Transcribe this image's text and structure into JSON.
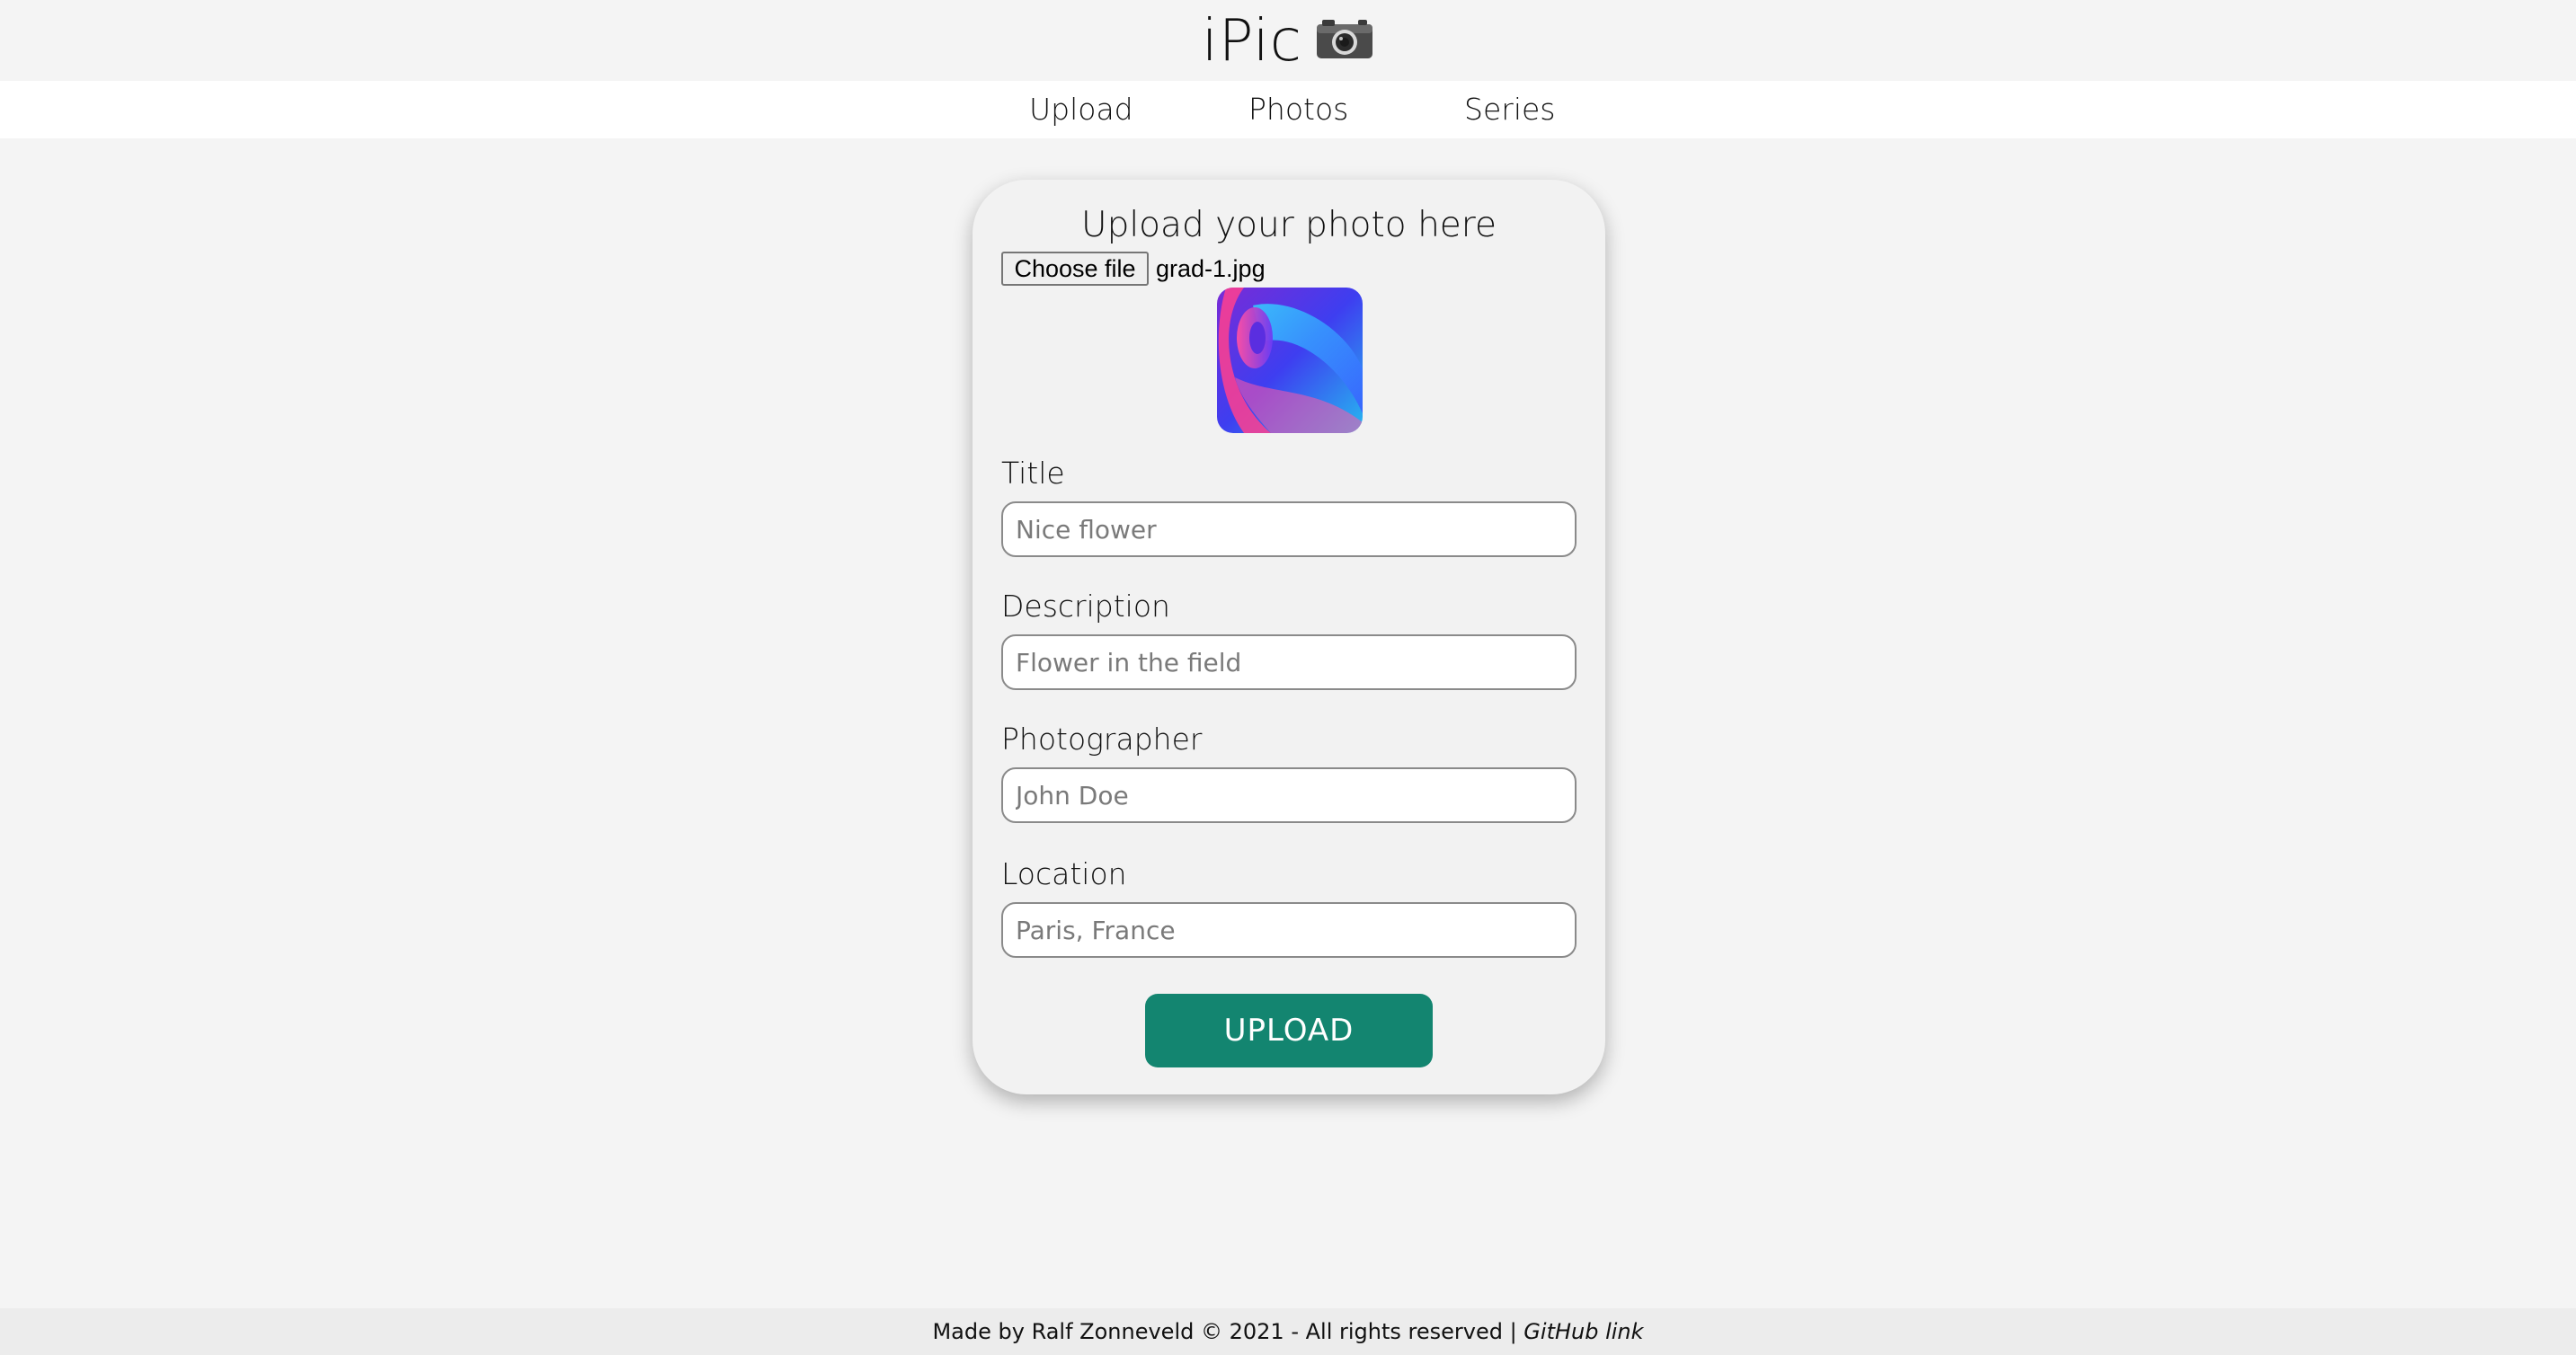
{
  "header": {
    "title": "iPic",
    "title_icon": "camera-icon"
  },
  "nav": {
    "items": [
      {
        "label": "Upload"
      },
      {
        "label": "Photos"
      },
      {
        "label": "Series"
      }
    ]
  },
  "form": {
    "heading": "Upload your photo here",
    "file_button_label": "Choose file",
    "file_name": "grad-1.jpg",
    "fields": [
      {
        "label": "Title",
        "placeholder": "Nice flower",
        "value": ""
      },
      {
        "label": "Description",
        "placeholder": "Flower in the field",
        "value": ""
      },
      {
        "label": "Photographer",
        "placeholder": "John Doe",
        "value": ""
      },
      {
        "label": "Location",
        "placeholder": "Paris, France",
        "value": ""
      }
    ],
    "submit_label": "UPLOAD"
  },
  "footer": {
    "text": "Made by Ralf Zonneveld © 2021 - All rights reserved | ",
    "link_label": "GitHub link"
  },
  "colors": {
    "accent": "#138570",
    "background": "#f4f4f4",
    "nav_background": "#ffffff"
  }
}
